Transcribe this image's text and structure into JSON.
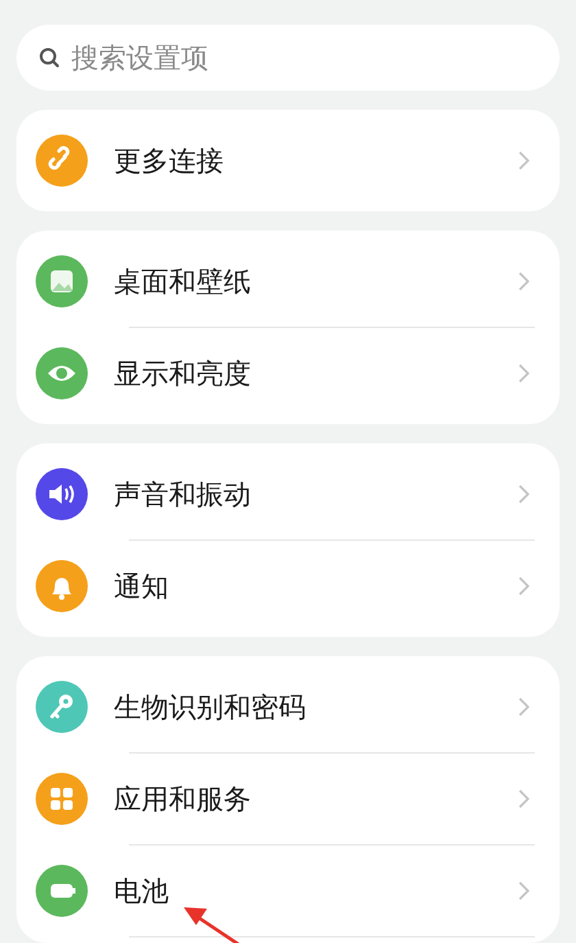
{
  "search": {
    "placeholder": "搜索设置项"
  },
  "groups": [
    {
      "items": [
        {
          "label": "更多连接",
          "color": "#f5a01a"
        }
      ]
    },
    {
      "items": [
        {
          "label": "桌面和壁纸",
          "color": "#5cb85c"
        },
        {
          "label": "显示和亮度",
          "color": "#5cb85c"
        }
      ]
    },
    {
      "items": [
        {
          "label": "声音和振动",
          "color": "#5548e8"
        },
        {
          "label": "通知",
          "color": "#f5a01a"
        }
      ]
    },
    {
      "items": [
        {
          "label": "生物识别和密码",
          "color": "#4fc7b6"
        },
        {
          "label": "应用和服务",
          "color": "#f5a01a"
        },
        {
          "label": "电池",
          "color": "#5cb85c",
          "annotated": true
        }
      ]
    }
  ]
}
